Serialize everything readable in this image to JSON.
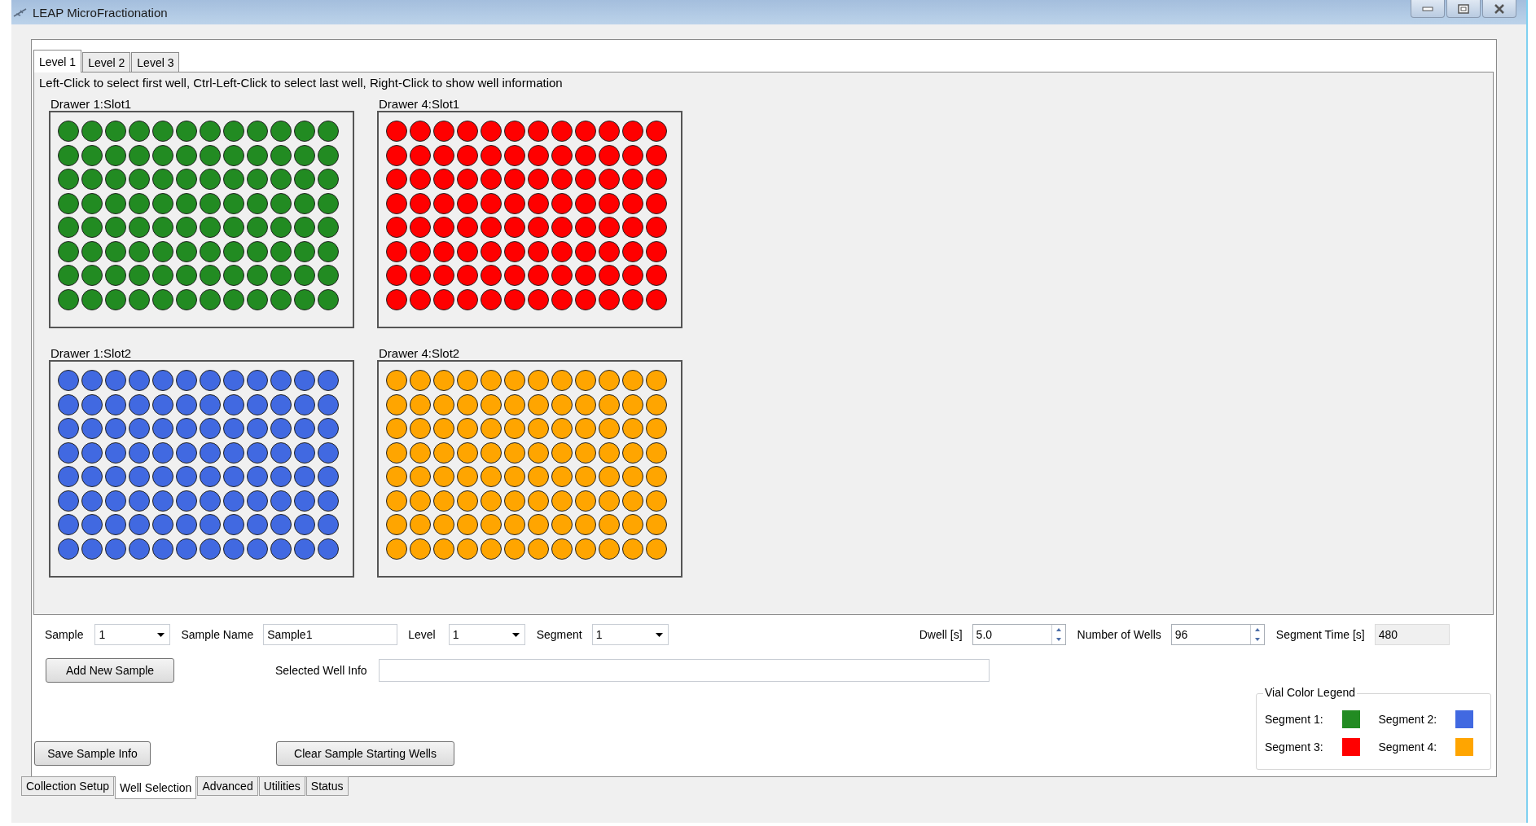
{
  "window": {
    "title": "LEAP MicroFractionation"
  },
  "level_tabs": [
    {
      "label": "Level 1",
      "selected": true
    },
    {
      "label": "Level 2",
      "selected": false
    },
    {
      "label": "Level 3",
      "selected": false
    }
  ],
  "instructions": "Left-Click to select first well, Ctrl-Left-Click to select last well, Right-Click to show well information",
  "plates": [
    {
      "label": "Drawer 1:Slot1",
      "color": "#228b22"
    },
    {
      "label": "Drawer 4:Slot1",
      "color": "#ff0000"
    },
    {
      "label": "Drawer 1:Slot2",
      "color": "#4169e1"
    },
    {
      "label": "Drawer 4:Slot2",
      "color": "#ffa500"
    }
  ],
  "form": {
    "sample": {
      "label": "Sample",
      "value": "1"
    },
    "sample_name": {
      "label": "Sample Name",
      "value": "Sample1"
    },
    "level": {
      "label": "Level",
      "value": "1"
    },
    "segment": {
      "label": "Segment",
      "value": "1"
    },
    "dwell": {
      "label": "Dwell [s]",
      "value": "5.0"
    },
    "number_of_wells": {
      "label": "Number of Wells",
      "value": "96"
    },
    "segment_time": {
      "label": "Segment Time [s]",
      "value": "480"
    },
    "selected_well_info": {
      "label": "Selected Well Info"
    }
  },
  "buttons": {
    "add_new_sample": "Add New Sample",
    "save_sample_info": "Save Sample Info",
    "clear_sample_starting_wells": "Clear Sample Starting Wells"
  },
  "legend": {
    "title": "Vial Color Legend",
    "items": [
      {
        "label": "Segment 1:",
        "color": "#228b22"
      },
      {
        "label": "Segment 2:",
        "color": "#4169e1"
      },
      {
        "label": "Segment 3:",
        "color": "#ff0000"
      },
      {
        "label": "Segment 4:",
        "color": "#ffa500"
      }
    ]
  },
  "main_tabs": [
    {
      "label": "Collection Setup",
      "selected": false
    },
    {
      "label": "Well Selection",
      "selected": true
    },
    {
      "label": "Advanced",
      "selected": false
    },
    {
      "label": "Utilities",
      "selected": false
    },
    {
      "label": "Status",
      "selected": false
    }
  ]
}
